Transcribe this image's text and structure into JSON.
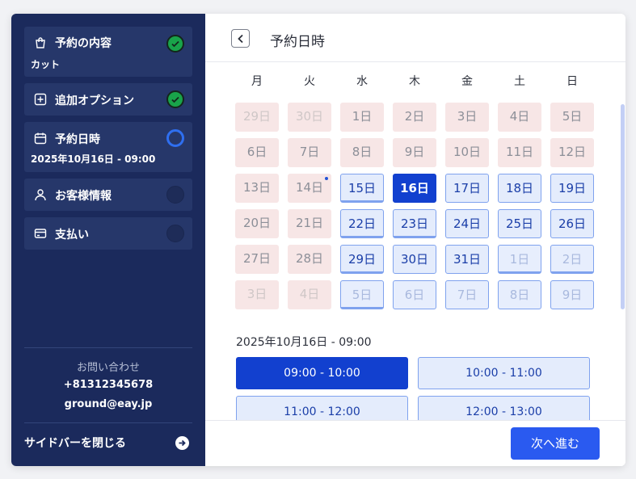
{
  "sidebar": {
    "steps": [
      {
        "label": "予約の内容",
        "sub": "カット",
        "status": "done",
        "icon": "bag-icon"
      },
      {
        "label": "追加オプション",
        "status": "done",
        "icon": "plus-square-icon"
      },
      {
        "label": "予約日時",
        "sub": "2025年10月16日 - 09:00",
        "status": "current",
        "icon": "calendar-icon"
      },
      {
        "label": "お客様情報",
        "status": "pending",
        "icon": "person-icon"
      },
      {
        "label": "支払い",
        "status": "pending",
        "icon": "card-icon"
      }
    ],
    "contact": {
      "heading": "お問い合わせ",
      "phone": "+81312345678",
      "email": "ground@eay.jp"
    },
    "close_label": "サイドバーを閉じる"
  },
  "main": {
    "title": "予約日時",
    "weekdays": [
      "月",
      "火",
      "水",
      "木",
      "金",
      "土",
      "日"
    ],
    "calendar": [
      [
        "29日",
        "30日",
        "1日",
        "2日",
        "3日",
        "4日",
        "5日"
      ],
      [
        "6日",
        "7日",
        "8日",
        "9日",
        "10日",
        "11日",
        "12日"
      ],
      [
        "13日",
        "14日",
        "15日",
        "16日",
        "17日",
        "18日",
        "19日"
      ],
      [
        "20日",
        "21日",
        "22日",
        "23日",
        "24日",
        "25日",
        "26日"
      ],
      [
        "27日",
        "28日",
        "29日",
        "30日",
        "31日",
        "1日",
        "2日"
      ],
      [
        "3日",
        "4日",
        "5日",
        "6日",
        "7日",
        "8日",
        "9日"
      ]
    ],
    "selected_datetime": "2025年10月16日 - 09:00",
    "time_slots": [
      "09:00 - 10:00",
      "10:00 - 11:00",
      "11:00 - 12:00",
      "12:00 - 13:00"
    ],
    "next_label": "次へ進む"
  },
  "colors": {
    "sidebar_bg": "#1b2a5c",
    "accent": "#1240cf",
    "primary_button": "#2a5af0",
    "done_status": "#19a34a",
    "unavailable_day": "#f7e6e6",
    "available_day": "#e4ecfc"
  }
}
